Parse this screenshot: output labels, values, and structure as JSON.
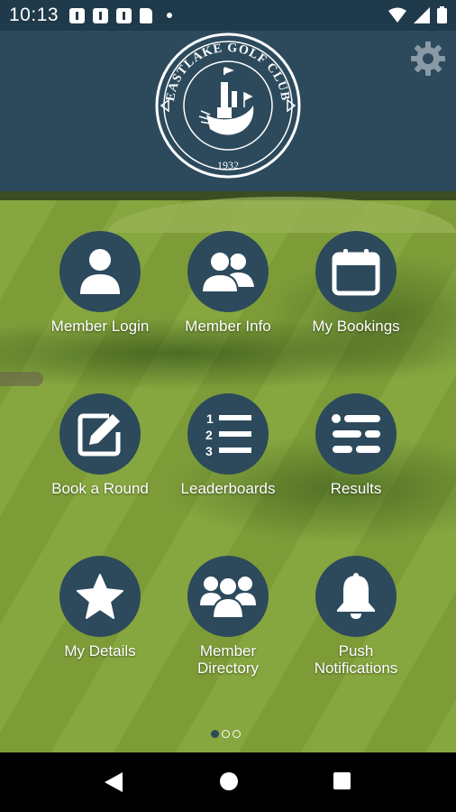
{
  "status_bar": {
    "time": "10:13",
    "notification_icons": [
      "message-icon",
      "message-icon",
      "message-icon",
      "sim-card-icon"
    ],
    "system_icons": [
      "wifi-icon",
      "signal-icon",
      "battery-icon"
    ]
  },
  "header": {
    "logo": {
      "name": "EASTLAKE GOLF CLUB",
      "year": "1932"
    },
    "settings_icon": "gear-icon",
    "colors": {
      "header_bg": "#2c4a5c",
      "status_bg": "#1f3a4a"
    }
  },
  "menu": {
    "items": [
      {
        "label": "Member Login",
        "icon": "person-icon"
      },
      {
        "label": "Member Info",
        "icon": "two-people-icon"
      },
      {
        "label": "My Bookings",
        "icon": "calendar-icon"
      },
      {
        "label": "Book a Round",
        "icon": "edit-icon"
      },
      {
        "label": "Leaderboards",
        "icon": "numbered-list-icon"
      },
      {
        "label": "Results",
        "icon": "list-icon"
      },
      {
        "label": "My Details",
        "icon": "star-icon"
      },
      {
        "label": "Member\nDirectory",
        "icon": "group-icon"
      },
      {
        "label": "Push\nNotifications",
        "icon": "bell-icon"
      }
    ]
  },
  "pager": {
    "pages": 3,
    "current": 1
  },
  "nav_bar": {
    "buttons": [
      "back-icon",
      "home-icon",
      "recent-apps-icon"
    ]
  }
}
